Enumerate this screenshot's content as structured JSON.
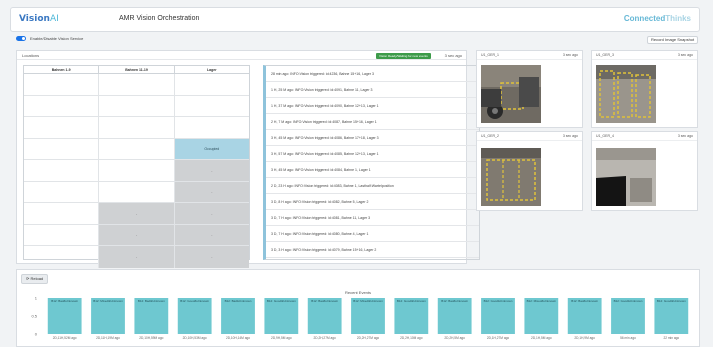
{
  "header": {
    "brand_main": "Vision",
    "brand_accent": "AI",
    "title": "AMR Vision Orchestration",
    "right_brand_main": "Connected",
    "right_brand_accent": "Thinks"
  },
  "controls": {
    "toggle_label": "Enable/Disable Vision Service",
    "toggle_on": true,
    "snapshot_label": "Record Image Snapshot"
  },
  "locations": {
    "title": "Locations",
    "status": "Vision Ready/Waiting for new events",
    "time": "3 sec ago",
    "columns": [
      "Bahnen 1-9",
      "Bahnen 11-19",
      "Lager"
    ],
    "rows": [
      [
        {
          "t": "",
          "s": ""
        },
        {
          "t": "",
          "s": ""
        },
        {
          "t": "",
          "s": ""
        }
      ],
      [
        {
          "t": "",
          "s": ""
        },
        {
          "t": "",
          "s": ""
        },
        {
          "t": "",
          "s": ""
        }
      ],
      [
        {
          "t": "",
          "s": ""
        },
        {
          "t": "",
          "s": ""
        },
        {
          "t": "",
          "s": ""
        }
      ],
      [
        {
          "t": "",
          "s": ""
        },
        {
          "t": "",
          "s": ""
        },
        {
          "t": "Occupied",
          "s": "occ"
        }
      ],
      [
        {
          "t": "",
          "s": ""
        },
        {
          "t": "",
          "s": ""
        },
        {
          "t": "-",
          "s": "gray"
        }
      ],
      [
        {
          "t": "",
          "s": ""
        },
        {
          "t": "",
          "s": ""
        },
        {
          "t": "-",
          "s": "gray"
        }
      ],
      [
        {
          "t": "",
          "s": ""
        },
        {
          "t": "-",
          "s": "gray"
        },
        {
          "t": "-",
          "s": "gray"
        }
      ],
      [
        {
          "t": "",
          "s": ""
        },
        {
          "t": "-",
          "s": "gray"
        },
        {
          "t": "-",
          "s": "gray"
        }
      ],
      [
        {
          "t": "",
          "s": ""
        },
        {
          "t": "-",
          "s": "gray"
        },
        {
          "t": "-",
          "s": "gray"
        }
      ]
    ],
    "log": [
      "28 min ago: INFO:Vision triggered: id:4236, Bahne 15+16, Lager 3",
      "1 H, 25 M ago: INFO:Vision triggered: id:4091, Bahne 11, Lager 3",
      "1 H, 37 M ago: INFO:Vision triggered: id:4090, Bahne 12+13, Lager 1",
      "2 H, 7 M ago: INFO:Vision triggered: id:4087, Bahne 15+16, Lager 1",
      "3 H, 45 M ago: INFO:Vision triggered: id:4086, Bahne 17+18, Lager 3",
      "3 H, 57 M ago: INFO:Vision triggered: id:4085, Bahne 12+13, Lager 1",
      "3 H, 45 M ago: INFO:Vision triggered: id:4084, Bahne 1, Lager 1",
      "2 D, 23 H ago: INFO:Vision triggered: id:4083, Bahne 1, Lasthalf:Wartelposition",
      "3 D, 8 H ago: INFO:Vision triggered: id:4082, Bahne 5, Lager 2",
      "3 D, 7 H ago: INFO:Vision triggered: id:4081, Bahne 11, Lager 3",
      "3 D, 7 H ago: INFO:Vision triggered: id:4080, Bahne 4, Lager 1",
      "3 D, 3 H ago: INFO:Vision triggered: id:4079, Bahne 15+16, Lager 2"
    ]
  },
  "cameras": [
    {
      "name": "U1_GER_1",
      "time": "3 sec ago"
    },
    {
      "name": "U1_GER_3",
      "time": "3 sec ago"
    },
    {
      "name": "U1_GER_2",
      "time": "3 sec ago"
    },
    {
      "name": "U1_GER_4",
      "time": "3 sec ago"
    }
  ],
  "reload_label": "⟳ Reload",
  "chart_data": {
    "type": "bar",
    "title": "Recent Events",
    "ylim": [
      0,
      1
    ],
    "yticks": [
      "1",
      "0.5",
      "0"
    ],
    "bar_color": "#6ec8d0",
    "bar_labels": [
      "B12: Bad&Unknown",
      "B12: Mixed&Unknown",
      "B12: Bad&Unknown",
      "B12: Good&Unknown",
      "B12: Bad&Unknown",
      "B12: Good&Unknown",
      "B12: Bad&Unknown",
      "B12: Mixed&Unknown",
      "B12: Good&Unknown",
      "B12: Bad&Unknown",
      "B12: Good&Unknown",
      "B12: Mixed&Unknown",
      "B12: Bad&Unknown",
      "B12: Good&Unknown",
      "B12: Good&Unknown"
    ],
    "categories": [
      "2D,11H,52M ago",
      "2D,11H,19M ago",
      "2D,10H,59M ago",
      "2D,10H,53M ago",
      "2D,10H,14M ago",
      "2D,9H,5M ago",
      "2D,2H,27M ago",
      "2D,2H,27M ago",
      "2D,2H,10M ago",
      "2D,2H,5M ago",
      "2D,1H,27M ago",
      "2D,1H,5M ago",
      "2D,1H,9M ago",
      "56 min ago",
      "22 min ago"
    ],
    "values": [
      1,
      1,
      1,
      1,
      1,
      1,
      1,
      1,
      1,
      1,
      1,
      1,
      1,
      1,
      1
    ]
  }
}
